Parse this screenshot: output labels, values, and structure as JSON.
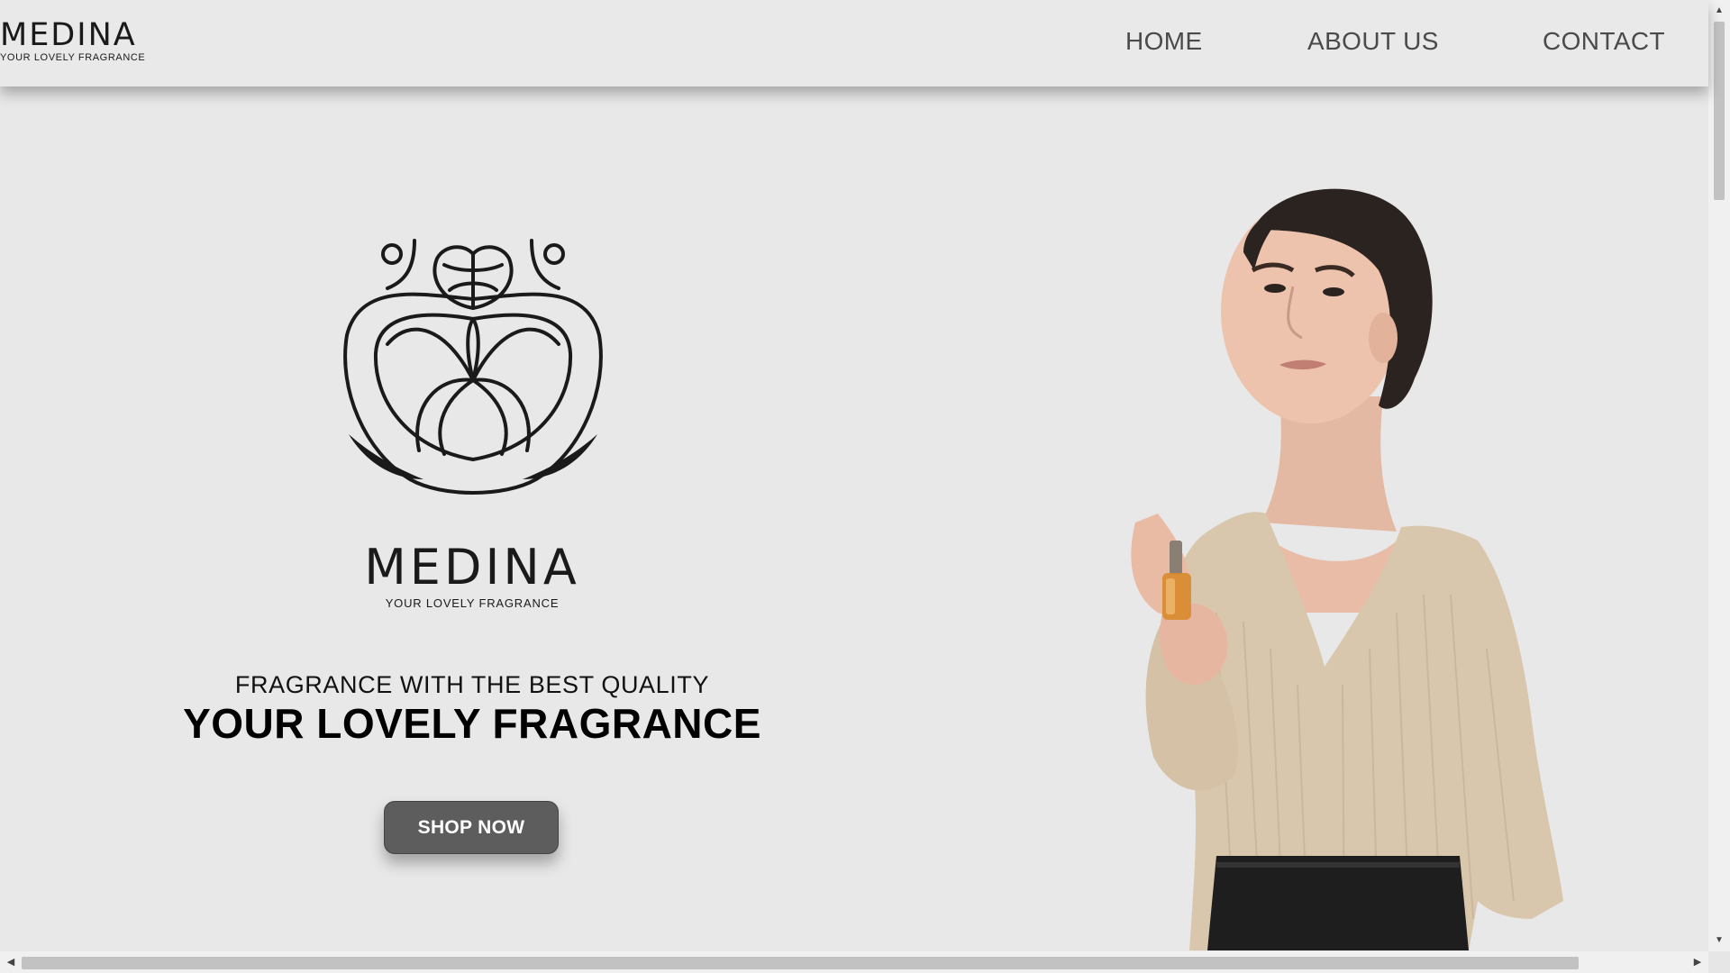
{
  "header": {
    "logo_name": "MEDINA",
    "logo_tagline": "YOUR LOVELY FRAGRANCE",
    "nav": {
      "home": "HOME",
      "about": "ABOUT US",
      "contact": "CONTACT"
    }
  },
  "hero": {
    "brand_name": "MEDINA",
    "brand_tagline": "YOUR LOVELY FRAGRANCE",
    "headline_small": "FRAGRANCE WITH THE BEST QUALITY",
    "headline_big": "YOUR LOVELY FRAGRANCE",
    "cta_label": "SHOP NOW"
  },
  "colors": {
    "background": "#e8e8e8",
    "nav_text": "#4a4a4a",
    "button": "#5d5d5d",
    "sweater": "#d9c7ad"
  }
}
